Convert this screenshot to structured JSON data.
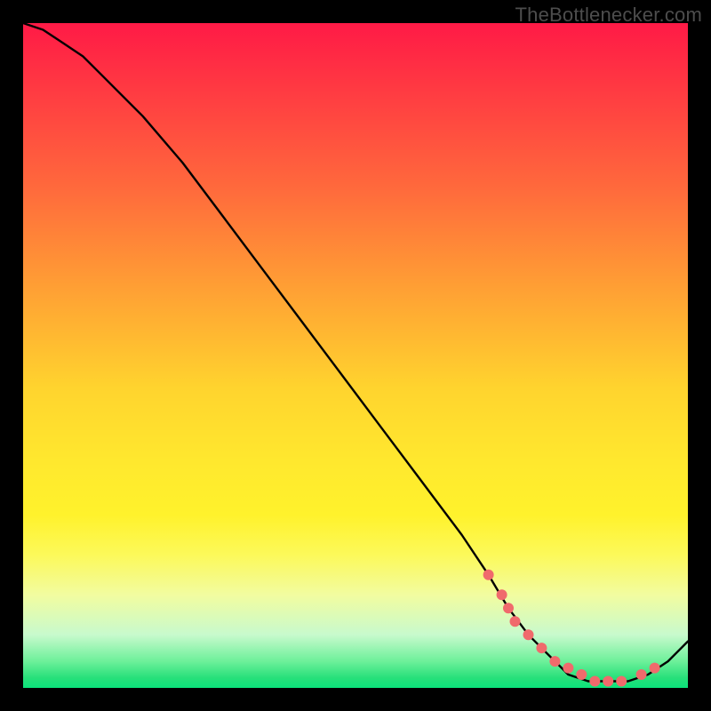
{
  "watermark": "TheBottlenecker.com",
  "chart_data": {
    "type": "line",
    "title": "",
    "subtitle": "",
    "xlabel": "",
    "ylabel": "",
    "xlim": [
      0,
      100
    ],
    "ylim": [
      0,
      100
    ],
    "grid": false,
    "legend": false,
    "annotations": [],
    "series": [
      {
        "name": "bottleneck-curve",
        "color": "#000000",
        "x": [
          0,
          3,
          6,
          9,
          12,
          18,
          24,
          30,
          36,
          42,
          48,
          54,
          60,
          66,
          70,
          73,
          76,
          79,
          82,
          85,
          88,
          91,
          94,
          97,
          100
        ],
        "y": [
          100,
          99,
          97,
          95,
          92,
          86,
          79,
          71,
          63,
          55,
          47,
          39,
          31,
          23,
          17,
          12,
          8,
          5,
          2,
          1,
          1,
          1,
          2,
          4,
          7
        ]
      }
    ],
    "markers": [
      {
        "name": "highlight-dots",
        "color": "#f06a6c",
        "radius": 6,
        "x": [
          70,
          72,
          73,
          74,
          76,
          78,
          80,
          82,
          84,
          86,
          88,
          90,
          93,
          95
        ],
        "y": [
          17,
          14,
          12,
          10,
          8,
          6,
          4,
          3,
          2,
          1,
          1,
          1,
          2,
          3
        ]
      }
    ],
    "background_gradient_stops": [
      {
        "pct": 0,
        "color": "#ff1a46"
      },
      {
        "pct": 25,
        "color": "#ff6a3c"
      },
      {
        "pct": 55,
        "color": "#ffd42e"
      },
      {
        "pct": 80,
        "color": "#fcf95a"
      },
      {
        "pct": 96,
        "color": "#6df09a"
      },
      {
        "pct": 100,
        "color": "#0be37b"
      }
    ]
  }
}
